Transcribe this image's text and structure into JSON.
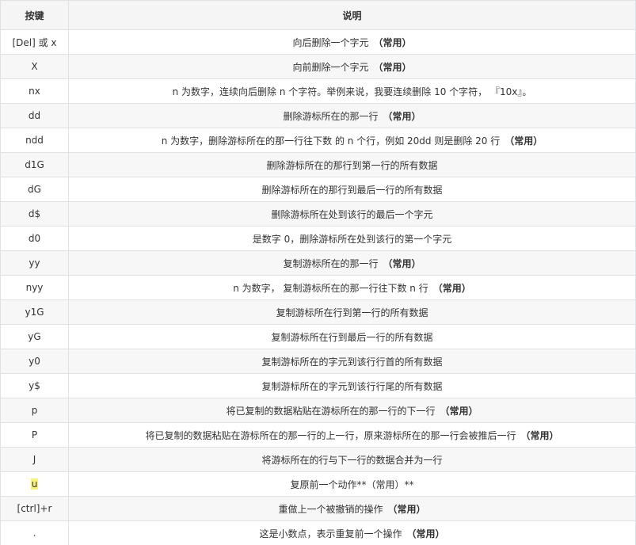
{
  "headers": {
    "key": "按键",
    "desc": "说明"
  },
  "common_label": "（常用）",
  "rows": [
    {
      "key": "[Del] 或 x",
      "desc": "向后删除一个字元",
      "common": "（常用）"
    },
    {
      "key": "X",
      "desc": "向前删除一个字元",
      "common": "（常用）"
    },
    {
      "key": "nx",
      "desc": "n 为数字，连续向后删除 n 个字符。举例来说，我要连续删除 10 个字符， 『10x』。",
      "common": ""
    },
    {
      "key": "dd",
      "desc": "删除游标所在的那一行",
      "common": "（常用）"
    },
    {
      "key": "ndd",
      "desc": "n 为数字，删除游标所在的那一行往下数 的 n 个行，例如 20dd 则是删除 20 行",
      "common": "（常用）"
    },
    {
      "key": "d1G",
      "desc": "删除游标所在的那行到第一行的所有数据",
      "common": ""
    },
    {
      "key": "dG",
      "desc": "删除游标所在的那行到最后一行的所有数据",
      "common": ""
    },
    {
      "key": "d$",
      "desc": "删除游标所在处到该行的最后一个字元",
      "common": ""
    },
    {
      "key": "d0",
      "desc": "是数字 0，删除游标所在处到该行的第一个字元",
      "common": ""
    },
    {
      "key": "yy",
      "desc": "复制游标所在的那一行",
      "common": "（常用）"
    },
    {
      "key": "nyy",
      "desc": "n 为数字， 复制游标所在的那一行往下数 n 行",
      "common": "（常用）"
    },
    {
      "key": "y1G",
      "desc": "复制游标所在行到第一行的所有数据",
      "common": ""
    },
    {
      "key": "yG",
      "desc": "复制游标所在行到最后一行的所有数据",
      "common": ""
    },
    {
      "key": "y0",
      "desc": "复制游标所在的字元到该行行首的所有数据",
      "common": ""
    },
    {
      "key": "y$",
      "desc": "复制游标所在的字元到该行行尾的所有数据",
      "common": ""
    },
    {
      "key": "p",
      "desc": "将已复制的数据粘贴在游标所在的那一行的下一行",
      "common": "（常用）"
    },
    {
      "key": "P",
      "desc": "将已复制的数据粘贴在游标所在的那一行的上一行，原来游标所在的那一行会被推后一行",
      "common": "（常用）"
    },
    {
      "key": "J",
      "desc": "将游标所在的行与下一行的数据合并为一行",
      "common": ""
    },
    {
      "key": "u",
      "desc": "复原前一个动作**（常用）**",
      "common": "",
      "highlight": true
    },
    {
      "key": "[ctrl]+r",
      "desc": "重做上一个被撤销的操作",
      "common": "（常用）"
    },
    {
      "key": ".",
      "desc": "这是小数点，表示重复前一个操作",
      "common": "（常用）"
    }
  ]
}
